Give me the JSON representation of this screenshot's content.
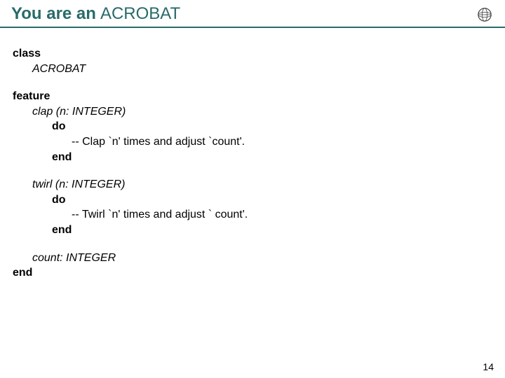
{
  "title": {
    "bold": "You are an",
    "normal": "ACROBAT"
  },
  "code": {
    "class_kw": "class",
    "class_name": "ACROBAT",
    "feature_kw": "feature",
    "clap_sig": "clap (n: INTEGER)",
    "do_kw": "do",
    "clap_comment": "-- Clap `n' times and adjust `count'.",
    "end_kw": "end",
    "twirl_sig": "twirl (n: INTEGER)",
    "twirl_comment": "-- Twirl `n' times and adjust ` count'.",
    "count_sig": "count: INTEGER",
    "end_class": "end"
  },
  "page_number": "14"
}
